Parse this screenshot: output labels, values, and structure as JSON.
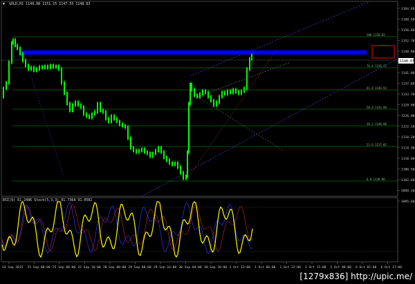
{
  "header": {
    "symbol": "GOLD,H1",
    "ohlc": "1149.88 1151.15 1147.55 1148.03"
  },
  "sub_header": "RSI(9) 61.2486 Stoch(5,3,3) 91.7364 91.0582",
  "current_price": "1148.03",
  "y_axis": [
    "1164.40",
    "1160.50",
    "1156.60",
    "1152.70",
    "1148.80",
    "1144.90",
    "1141.00",
    "1137.60",
    "1133.70",
    "1129.90",
    "1126.00",
    "1122.10",
    "1118.20",
    "1114.30",
    "1110.40",
    "1106.50",
    "1102.60",
    "1099.30",
    "1095.40"
  ],
  "x_axis": [
    "24 Sep 2015",
    "25 Sep 00:00",
    "25 Sep 08:00",
    "25 Sep 16:00",
    "28 Sep 00:00",
    "29 Sep 08:00",
    "29 Sep 16:00",
    "30 Sep 04:00",
    "30 Sep 20:00",
    "1 Oct 13:00",
    "1 Oct 06:00",
    "1 Oct 22:00",
    "2 Oct 15:00",
    "5 Oct 08:00",
    "6 Oct 01:00",
    "6 Oct 17:00"
  ],
  "fib_levels": [
    {
      "label": "100 1156.83"
    },
    {
      "label": "76.4 1150.71"
    },
    {
      "label": "61.8 1146.92"
    },
    {
      "label": "50.0 1143.86"
    },
    {
      "label": "38.2 1140.80"
    },
    {
      "label": "23.6 1137.02"
    },
    {
      "label": "0.0 1130.90"
    }
  ],
  "watermark": "[1279x836] http://upic.me/",
  "colors": {
    "candles": "#00ff00",
    "resistance_band": "#0000ff",
    "highlight_box": "#ff0000",
    "fib": "#00aa00",
    "channel": "#5555ff",
    "rsi": "#ffff00",
    "stoch_main": "#3333ff",
    "stoch_signal": "#ff3333",
    "grid": "#333333"
  }
}
